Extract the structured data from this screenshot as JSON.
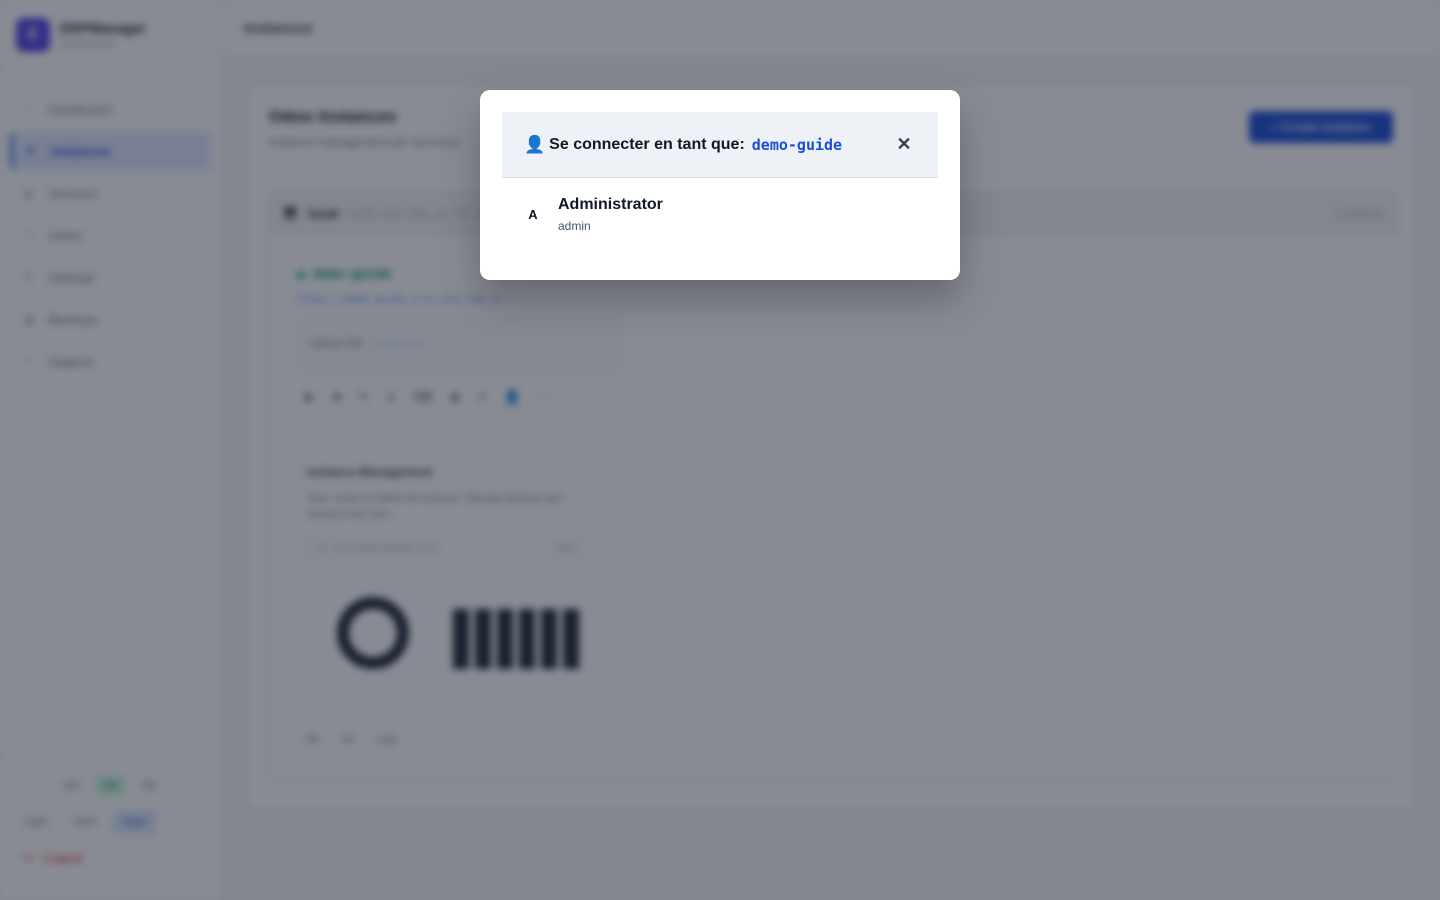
{
  "app": {
    "name": "ERPManager",
    "subtitle": "Dashboard",
    "logo_letter": "E"
  },
  "sidebar": {
    "items": [
      {
        "label": "Dashboard",
        "icon": "home-icon",
        "glyph": "⌂"
      },
      {
        "label": "Instances",
        "icon": "box-icon",
        "glyph": "■",
        "active": true
      },
      {
        "label": "Versions",
        "icon": "tag-icon",
        "glyph": "◆"
      },
      {
        "label": "Users",
        "icon": "users-icon",
        "glyph": "☺"
      },
      {
        "label": "Settings",
        "icon": "gear-icon",
        "glyph": "⚙"
      },
      {
        "label": "Backups",
        "icon": "archive-icon",
        "glyph": "▣"
      },
      {
        "label": "Support",
        "icon": "help-icon",
        "glyph": "?"
      }
    ],
    "languages": [
      "EN",
      "FR",
      "DE"
    ],
    "themes": [
      "Light",
      "Dark",
      "Auto"
    ],
    "logout_label": "Logout"
  },
  "topbar": {
    "title": "Instances"
  },
  "main": {
    "title": "Odoo Instances",
    "subtitle": "Instance management per server(s)",
    "create_label": "+ Create Instance",
    "server": {
      "name": "local",
      "host": "srv1.erp-lab.io  (8 instances)",
      "count": "1 instance"
    },
    "instance": {
      "name": "demo-guide",
      "url": "https://demo-guide.srv1.erp-lab.io",
      "password_label": "Admin PW",
      "password_mask": "••••••••••",
      "tools": [
        "▶",
        "■",
        "↻",
        "●",
        "⌨",
        "◆",
        "≡",
        "👤",
        "⋯"
      ],
      "mgmt_title": "Instance Management",
      "mgmt_text": "Stop, restart or delete the instance. Manage backups and domains from here.",
      "mgmt_placeholder": "ex: my-custom-domain.com",
      "mgmt_button": "Save",
      "chips": [
        "DB",
        "Up",
        "Logs"
      ]
    }
  },
  "modal": {
    "title_prefix": "Se connecter en tant que:",
    "instance_name": "demo-guide",
    "user_icon": "user-icon",
    "close_glyph": "✕",
    "users": [
      {
        "avatar": "A",
        "name": "Administrator",
        "login": "admin"
      }
    ]
  },
  "colors": {
    "accent": "#1d4ed8",
    "overlay": "rgba(17,24,39,0.5)",
    "active_status": "#10b981"
  }
}
